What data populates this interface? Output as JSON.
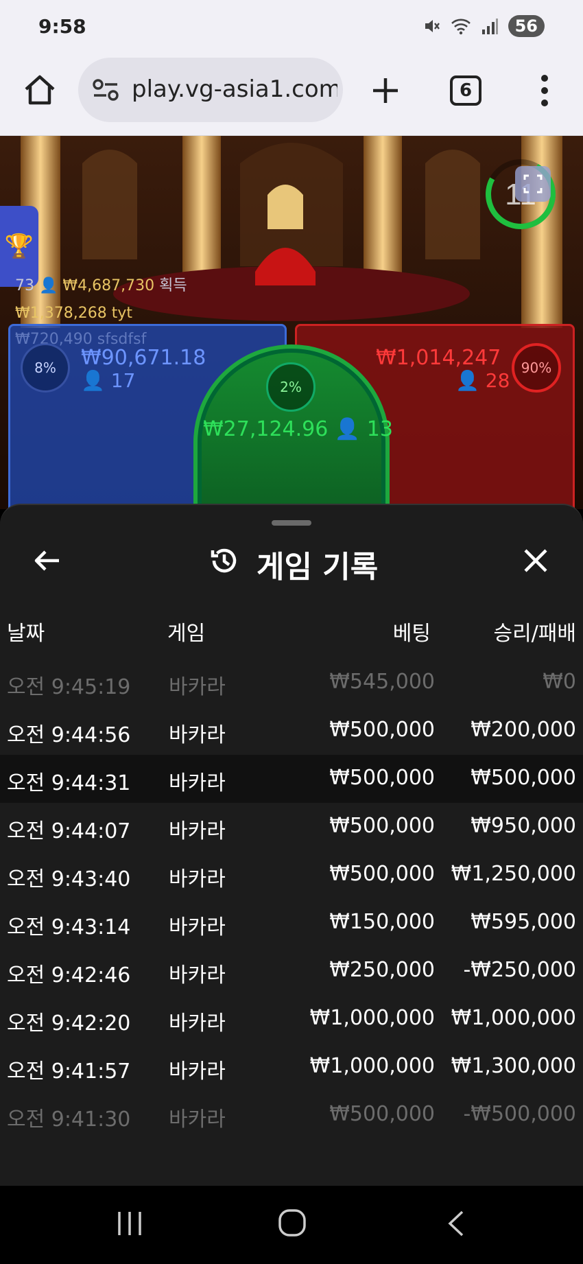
{
  "status_bar": {
    "time": "9:58",
    "battery": "56"
  },
  "browser": {
    "url": "play.vg-asia1.com",
    "tab_count": "6"
  },
  "game": {
    "timer": "11",
    "players_count": "73",
    "total_win": "₩4,687,730",
    "total_win_suffix": "획득",
    "recent_win": "₩1,378,268",
    "recent_win_user": "tyt",
    "ghost_win": "₩720,490",
    "ghost_user": "sfsdfsf",
    "player": {
      "percent": "8%",
      "amount": "₩90,671.18",
      "count": "17"
    },
    "banker": {
      "percent": "90%",
      "amount": "₩1,014,247",
      "count": "28"
    },
    "tie": {
      "percent": "2%",
      "amount": "₩27,124.96",
      "count": "13"
    }
  },
  "sheet": {
    "title": "게임 기록",
    "columns": {
      "date": "날짜",
      "game": "게임",
      "bet": "베팅",
      "result": "승리/패배"
    },
    "rows": [
      {
        "date": "오전 9:45:19",
        "game": "바카라",
        "bet": "₩545,000",
        "result": "₩0"
      },
      {
        "date": "오전 9:44:56",
        "game": "바카라",
        "bet": "₩500,000",
        "result": "₩200,000"
      },
      {
        "date": "오전 9:44:31",
        "game": "바카라",
        "bet": "₩500,000",
        "result": "₩500,000"
      },
      {
        "date": "오전 9:44:07",
        "game": "바카라",
        "bet": "₩500,000",
        "result": "₩950,000"
      },
      {
        "date": "오전 9:43:40",
        "game": "바카라",
        "bet": "₩500,000",
        "result": "₩1,250,000"
      },
      {
        "date": "오전 9:43:14",
        "game": "바카라",
        "bet": "₩150,000",
        "result": "₩595,000"
      },
      {
        "date": "오전 9:42:46",
        "game": "바카라",
        "bet": "₩250,000",
        "result": "-₩250,000"
      },
      {
        "date": "오전 9:42:20",
        "game": "바카라",
        "bet": "₩1,000,000",
        "result": "₩1,000,000"
      },
      {
        "date": "오전 9:41:57",
        "game": "바카라",
        "bet": "₩1,000,000",
        "result": "₩1,300,000"
      },
      {
        "date": "오전 9:41:30",
        "game": "바카라",
        "bet": "₩500,000",
        "result": "-₩500,000"
      }
    ]
  }
}
